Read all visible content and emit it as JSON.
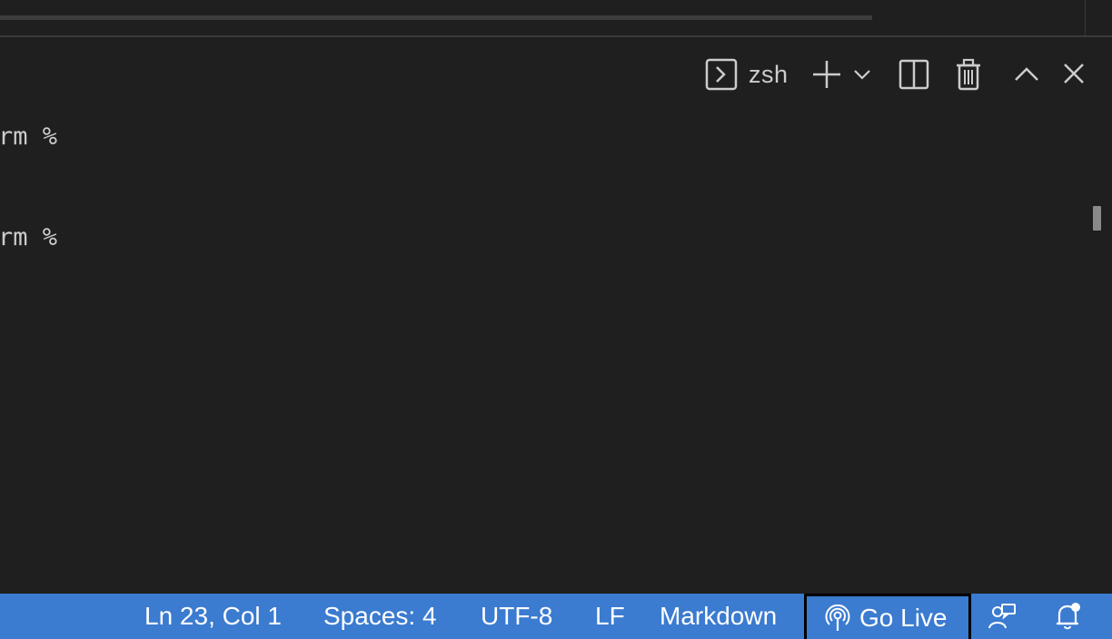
{
  "terminal": {
    "shell_name": "zsh",
    "lines": [
      "rm %",
      "rm %"
    ]
  },
  "toolbar": {
    "icons": [
      "terminal-icon",
      "plus-icon",
      "chevron-down-icon",
      "split-icon",
      "trash-icon",
      "chevron-up-icon",
      "close-icon"
    ]
  },
  "status_bar": {
    "cursor_position": "Ln 23, Col 1",
    "indentation": "Spaces: 4",
    "encoding": "UTF-8",
    "line_ending": "LF",
    "language": "Markdown",
    "go_live": "Go Live",
    "colors": {
      "background": "#3b7bd0",
      "text": "#ffffff",
      "highlight_border": "#000000"
    }
  }
}
